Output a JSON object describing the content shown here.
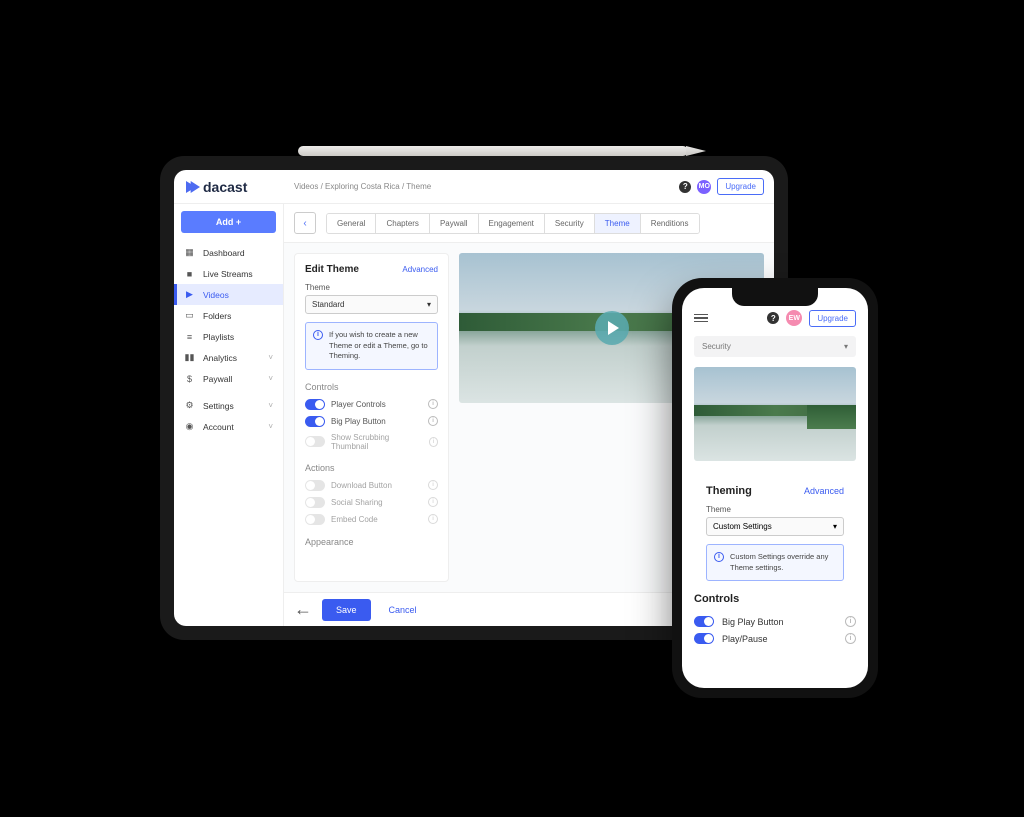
{
  "brand": "dacast",
  "breadcrumb": {
    "a": "Videos",
    "b": "Exploring Costa Rica",
    "c": "Theme",
    "sep": "/"
  },
  "header": {
    "help": "?",
    "avatar": "MO",
    "upgrade": "Upgrade"
  },
  "sidebar": {
    "addLabel": "Add +",
    "items": [
      {
        "label": "Dashboard",
        "icon": "grid"
      },
      {
        "label": "Live Streams",
        "icon": "cam"
      },
      {
        "label": "Videos",
        "icon": "play",
        "active": true
      },
      {
        "label": "Folders",
        "icon": "folder"
      },
      {
        "label": "Playlists",
        "icon": "list"
      },
      {
        "label": "Analytics",
        "icon": "bars",
        "chev": true
      },
      {
        "label": "Paywall",
        "icon": "dollar",
        "chev": true
      },
      {
        "label": "Settings",
        "icon": "gear",
        "chev": true
      },
      {
        "label": "Account",
        "icon": "user",
        "chev": true
      }
    ]
  },
  "tabs": {
    "items": [
      "General",
      "Chapters",
      "Paywall",
      "Engagement",
      "Security",
      "Theme",
      "Renditions"
    ],
    "active": "Theme",
    "backGlyph": "‹"
  },
  "panel": {
    "title": "Edit Theme",
    "advanced": "Advanced",
    "themeLabel": "Theme",
    "themeValue": "Standard",
    "chev": "▾",
    "info": "If you wish to create a new Theme or edit a Theme, go to Theming.",
    "controls": {
      "title": "Controls",
      "items": [
        {
          "label": "Player Controls",
          "on": true
        },
        {
          "label": "Big Play Button",
          "on": true
        },
        {
          "label": "Show Scrubbing Thumbnail",
          "on": false,
          "disabled": true
        }
      ]
    },
    "actions": {
      "title": "Actions",
      "items": [
        {
          "label": "Download Button",
          "on": false,
          "disabled": true
        },
        {
          "label": "Social Sharing",
          "on": false,
          "disabled": true
        },
        {
          "label": "Embed Code",
          "on": false,
          "disabled": true
        }
      ]
    },
    "appearance": {
      "title": "Appearance"
    }
  },
  "bottom": {
    "save": "Save",
    "cancel": "Cancel",
    "backGlyph": "←"
  },
  "phone": {
    "help": "?",
    "avatar": "EW",
    "upgrade": "Upgrade",
    "selector": "Security",
    "chev": "▾",
    "theming": {
      "title": "Theming",
      "advanced": "Advanced",
      "themeLabel": "Theme",
      "themeValue": "Custom Settings",
      "info": "Custom Settings override any Theme settings."
    },
    "controls": {
      "title": "Controls",
      "items": [
        {
          "label": "Big Play Button",
          "on": true
        },
        {
          "label": "Play/Pause",
          "on": true
        }
      ]
    }
  },
  "iconInfo": "i",
  "tooltipGlyph": "i"
}
